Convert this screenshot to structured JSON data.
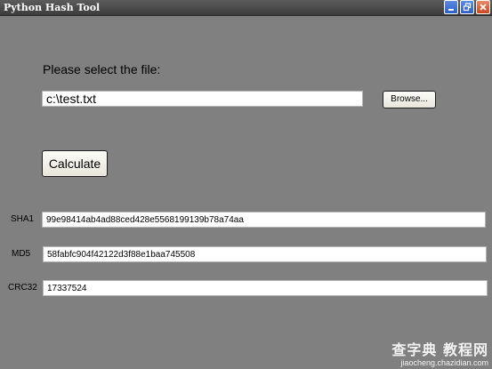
{
  "window": {
    "title": "Python Hash Tool"
  },
  "file_section": {
    "prompt": "Please select the file:",
    "file_path": "c:\\test.txt",
    "browse_label": "Browse..."
  },
  "actions": {
    "calculate_label": "Calculate"
  },
  "hashes": [
    {
      "label": "SHA1",
      "value": "99e98414ab4ad88ced428e5568199139b78a74aa"
    },
    {
      "label": "MD5",
      "value": "58fabfc904f42122d3f88e1baa745508"
    },
    {
      "label": "CRC32",
      "value": "17337524"
    }
  ],
  "watermark": {
    "main": "查字典 教程网",
    "sub": "jiaocheng.chazidian.com"
  },
  "colors": {
    "client_background": "#808080",
    "titlebar": "#4a4a4a",
    "close_button": "#c9461f",
    "system_button": "#2f5fc4"
  },
  "icons": {
    "minimize": "minimize-icon",
    "restore": "restore-icon",
    "close": "close-icon"
  }
}
